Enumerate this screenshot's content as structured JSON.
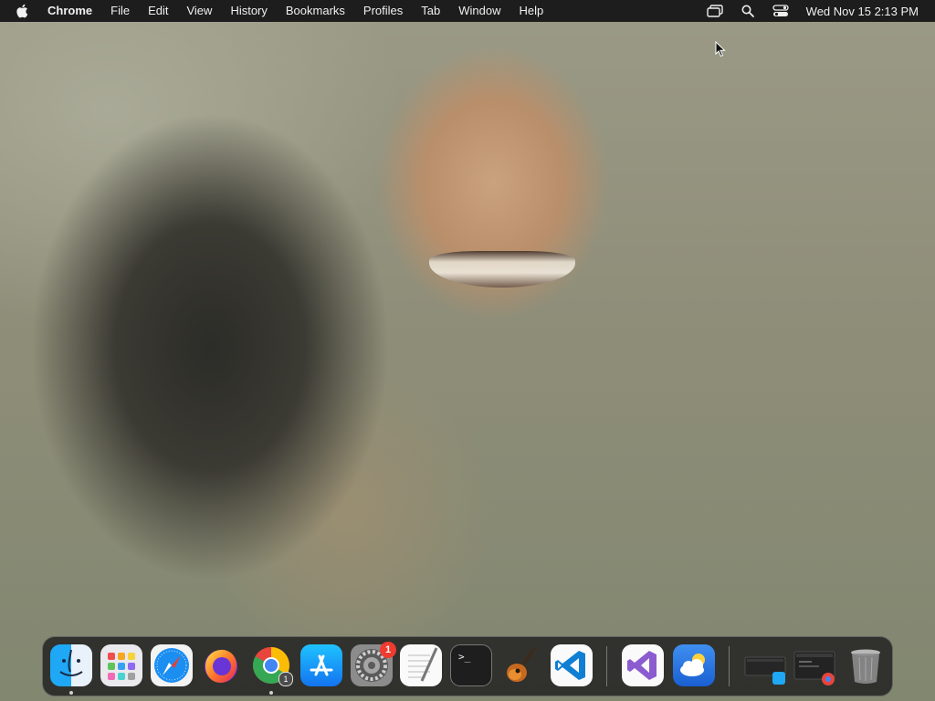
{
  "menubar": {
    "app_name": "Chrome",
    "menus": [
      "File",
      "Edit",
      "View",
      "History",
      "Bookmarks",
      "Profiles",
      "Tab",
      "Window",
      "Help"
    ],
    "status_icons": [
      "screen-mirroring-icon",
      "spotlight-search-icon",
      "control-center-icon"
    ],
    "clock": "Wed Nov 15  2:13 PM"
  },
  "dock": {
    "apps": [
      {
        "name": "Finder",
        "icon": "finder-icon",
        "running": true
      },
      {
        "name": "Launchpad",
        "icon": "launchpad-icon",
        "running": false
      },
      {
        "name": "Safari",
        "icon": "safari-icon",
        "running": false
      },
      {
        "name": "Firefox",
        "icon": "firefox-icon",
        "running": false
      },
      {
        "name": "Google Chrome",
        "icon": "chrome-icon",
        "running": true,
        "window_count": "1"
      },
      {
        "name": "App Store",
        "icon": "app-store-icon",
        "running": false
      },
      {
        "name": "System Settings",
        "icon": "settings-gear-icon",
        "running": false,
        "badge": "1"
      },
      {
        "name": "TextEdit",
        "icon": "textedit-icon",
        "running": false
      },
      {
        "name": "Terminal",
        "icon": "terminal-icon",
        "running": false
      },
      {
        "name": "GarageBand",
        "icon": "garageband-icon",
        "running": false
      },
      {
        "name": "Visual Studio Code",
        "icon": "vscode-icon",
        "running": false
      },
      {
        "name": "Visual Studio",
        "icon": "visual-studio-icon",
        "running": false
      },
      {
        "name": "Weather",
        "icon": "weather-icon",
        "running": false
      }
    ],
    "minimized": [
      {
        "name": "Minimized Finder window",
        "icon": "minimized-window-finder-icon"
      },
      {
        "name": "Minimized Chrome window",
        "icon": "minimized-window-chrome-icon"
      }
    ],
    "trash": {
      "name": "Trash",
      "icon": "trash-icon"
    },
    "terminal_prompt": ">_"
  },
  "colors": {
    "menubar_bg": "#1d1d1d",
    "badge_red": "#ef3b30",
    "dock_bg": "rgba(30,30,30,0.82)"
  }
}
